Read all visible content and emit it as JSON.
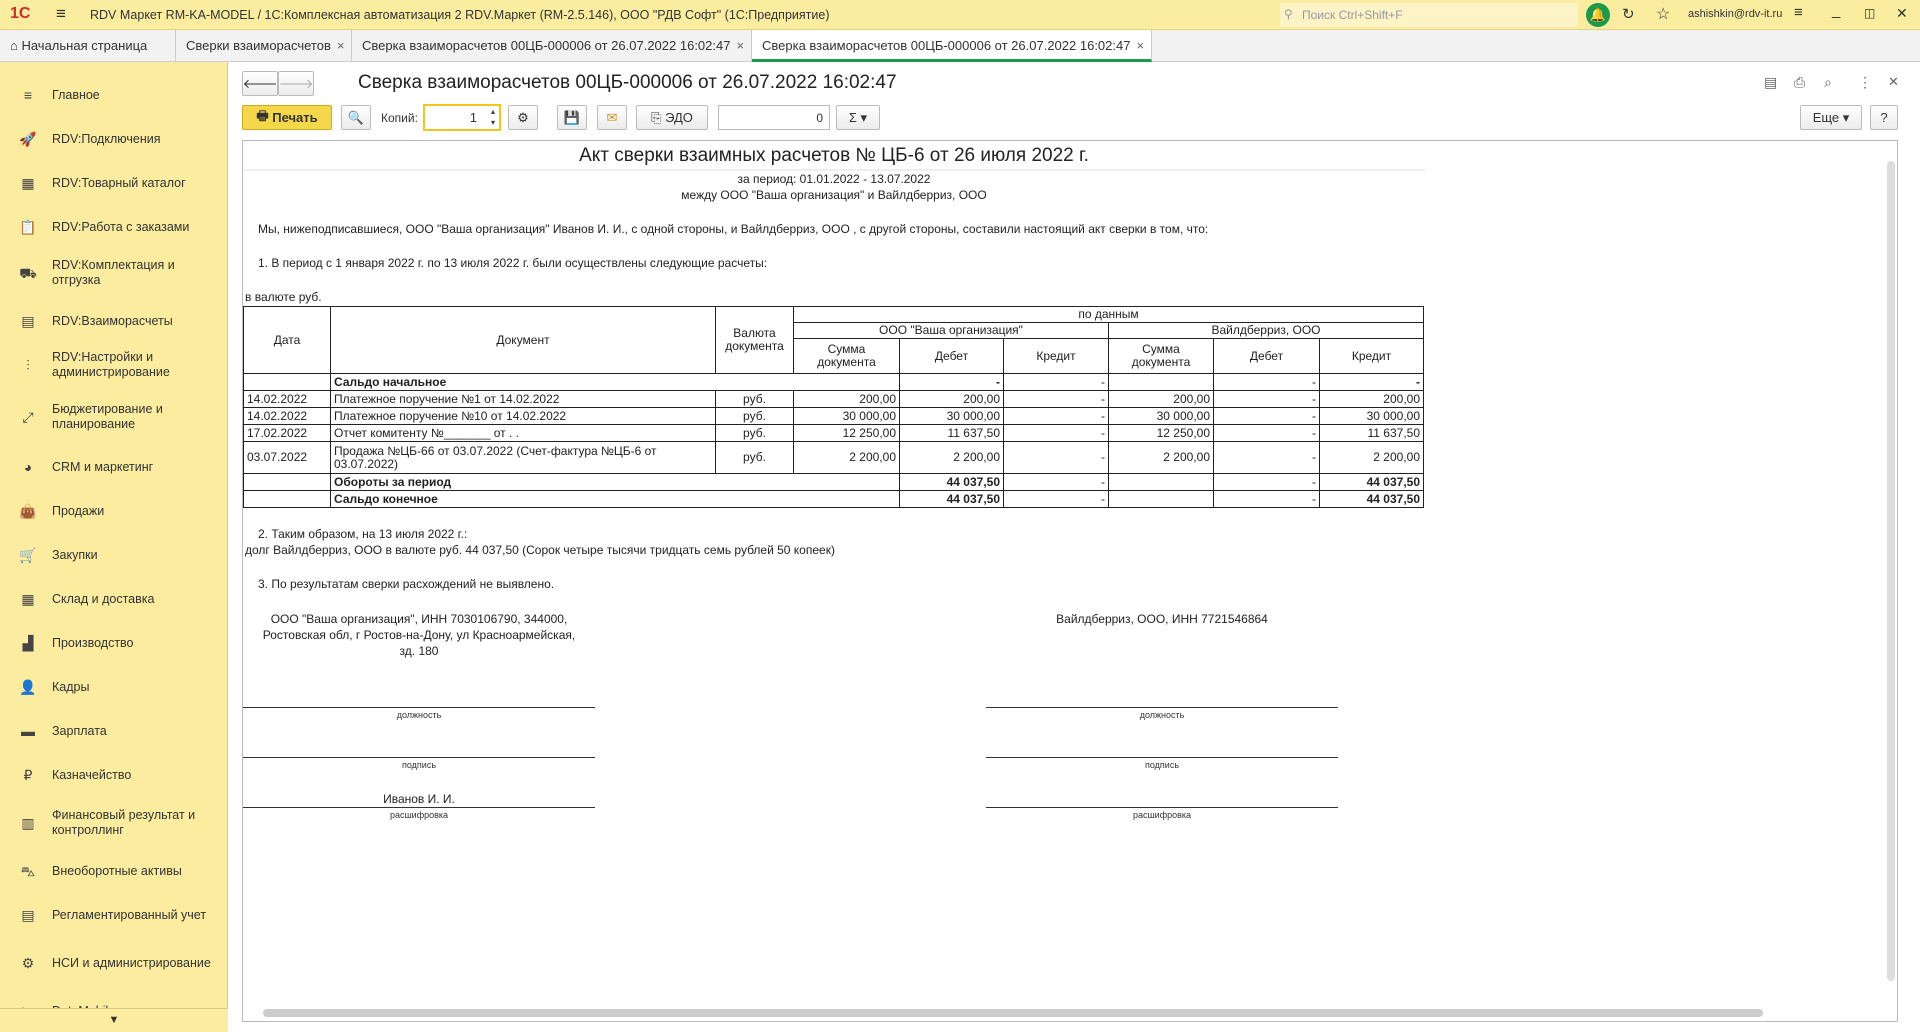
{
  "titlebar": {
    "logo": "1С",
    "title": "RDV Маркет RM-KA-MODEL / 1С:Комплексная автоматизация 2 RDV.Маркет (RM-2.5.146), ООО \"РДВ Софт\"  (1С:Предприятие)",
    "search_placeholder": "Поиск Ctrl+Shift+F",
    "user": "ashishkin@rdv-it.ru"
  },
  "tabs": [
    {
      "label": "Начальная страница"
    },
    {
      "label": "Сверки взаиморасчетов"
    },
    {
      "label": "Сверка взаиморасчетов 00ЦБ-000006 от 26.07.2022 16:02:47"
    },
    {
      "label": "Сверка взаиморасчетов 00ЦБ-000006 от 26.07.2022 16:02:47"
    }
  ],
  "sidebar": [
    {
      "label": "Главное",
      "icon": "≡"
    },
    {
      "label": "RDV:Подключения",
      "icon": "🚀"
    },
    {
      "label": "RDV:Товарный каталог",
      "icon": "▦"
    },
    {
      "label": "RDV:Работа с заказами",
      "icon": "📋"
    },
    {
      "label": "RDV:Комплектация и отгрузка",
      "icon": "⛟"
    },
    {
      "label": "RDV:Взаиморасчеты",
      "icon": "▤"
    },
    {
      "label": "RDV:Настройки и администрирование",
      "icon": "⫶"
    },
    {
      "label": "Бюджетирование и планирование",
      "icon": "⤢"
    },
    {
      "label": "CRM и маркетинг",
      "icon": "◕"
    },
    {
      "label": "Продажи",
      "icon": "👜"
    },
    {
      "label": "Закупки",
      "icon": "🛒"
    },
    {
      "label": "Склад и доставка",
      "icon": "▦"
    },
    {
      "label": "Производство",
      "icon": "▟"
    },
    {
      "label": "Кадры",
      "icon": "👤"
    },
    {
      "label": "Зарплата",
      "icon": "▬"
    },
    {
      "label": "Казначейство",
      "icon": "₽"
    },
    {
      "label": "Финансовый результат и контроллинг",
      "icon": "▥"
    },
    {
      "label": "Внеоборотные активы",
      "icon": "⛍"
    },
    {
      "label": "Регламентированный учет",
      "icon": "▤"
    },
    {
      "label": "НСИ и администрирование",
      "icon": "⚙"
    },
    {
      "label": "DataMobile",
      "icon": "◣"
    }
  ],
  "form": {
    "title": "Сверка взаиморасчетов 00ЦБ-000006 от 26.07.2022 16:02:47",
    "print": "Печать",
    "copies_label": "Копий:",
    "copies": "1",
    "edo": "ЭДО",
    "sum": "0",
    "more": "Еще",
    "help": "?"
  },
  "doc": {
    "title": "Акт сверки взаимных расчетов № ЦБ-6 от 26 июля 2022 г.",
    "period": "за период: 01.01.2022 - 13.07.2022",
    "between": "между ООО \"Ваша организация\" и Вайлдберриз, ООО",
    "intro": "Мы, нижеподписавшиеся,  ООО \"Ваша организация\" Иванов И. И., с одной стороны, и  Вайлдберриз, ООО , с другой стороны, составили настоящий акт сверки в том, что:",
    "p1": "1. В период с 1 января 2022 г. по 13 июля 2022 г. были осуществлены следующие расчеты:",
    "currency": "в валюте руб.",
    "headers": {
      "date": "Дата",
      "document": "Документ",
      "currency": "Валюта документа",
      "by_data": "по данным",
      "org1": "ООО \"Ваша организация\"",
      "org2": "Вайлдберриз, ООО",
      "sum": "Сумма документа",
      "debit": "Дебет",
      "credit": "Кредит"
    },
    "opening": {
      "label": "Сальдо начальное",
      "d1": "-",
      "c1": "-",
      "d2": "-",
      "c2": "-"
    },
    "rows": [
      {
        "date": "14.02.2022",
        "doc": "Платежное поручение №1 от 14.02.2022",
        "cur": "руб.",
        "s1": "200,00",
        "d1": "200,00",
        "c1": "-",
        "s2": "200,00",
        "d2": "-",
        "c2": "200,00"
      },
      {
        "date": "14.02.2022",
        "doc": "Платежное поручение №10 от 14.02.2022",
        "cur": "руб.",
        "s1": "30 000,00",
        "d1": "30 000,00",
        "c1": "-",
        "s2": "30 000,00",
        "d2": "-",
        "c2": "30 000,00"
      },
      {
        "date": "17.02.2022",
        "doc": "Отчет комитенту №_______ от   .  .",
        "cur": "руб.",
        "s1": "12 250,00",
        "d1": "11 637,50",
        "c1": "-",
        "s2": "12 250,00",
        "d2": "-",
        "c2": "11 637,50"
      },
      {
        "date": "03.07.2022",
        "doc": "Продажа №ЦБ-66 от 03.07.2022 (Счет-фактура №ЦБ-6 от 03.07.2022)",
        "cur": "руб.",
        "s1": "2 200,00",
        "d1": "2 200,00",
        "c1": "-",
        "s2": "2 200,00",
        "d2": "-",
        "c2": "2 200,00"
      }
    ],
    "turnover": {
      "label": "Обороты за период",
      "d1": "44 037,50",
      "c1": "-",
      "d2": "-",
      "c2": "44 037,50"
    },
    "closing": {
      "label": "Сальдо конечное",
      "d1": "44 037,50",
      "c1": "-",
      "d2": "-",
      "c2": "44 037,50"
    },
    "p2": "2. Таким образом, на 13 июля 2022 г.:",
    "debt": "долг Вайлдберриз, ООО в валюте руб. 44 037,50 (Сорок четыре тысячи тридцать семь рублей 50 копеек)",
    "p3": "3. По результатам сверки расхождений не выявлено.",
    "org1_line1": "ООО \"Ваша организация\", ИНН 7030106790, 344000,",
    "org1_line2": "Ростовская обл, г Ростов-на-Дону, ул Красноармейская,",
    "org1_line3": "зд. 180",
    "org2_line": "Вайлдберриз, ООО, ИНН 7721546864",
    "position": "должность",
    "signature": "подпись",
    "decoding": "расшифровка",
    "signer1": "Иванов И. И."
  }
}
